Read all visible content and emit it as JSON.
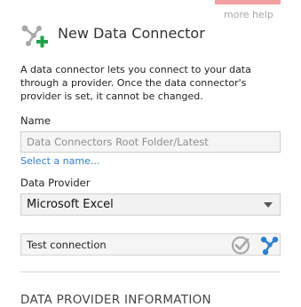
{
  "help": {
    "more_help": "more help"
  },
  "header": {
    "title": "New Data Connector",
    "icon": "data-connector-add-icon"
  },
  "description": "A data connector lets you connect to your data through a provider. Once the data connector's provider is set, it cannot be changed.",
  "name_field": {
    "label": "Name",
    "value": "Data Connectors Root Folder/Latest",
    "select_link": "Select a name..."
  },
  "provider": {
    "label": "Data Provider",
    "selected": "Microsoft Excel"
  },
  "test": {
    "label": "Test connection",
    "check_icon": "check-circle-icon",
    "connect_icon": "connection-icon"
  },
  "section": {
    "title": "DATA PROVIDER INFORMATION"
  },
  "colors": {
    "accent": "#2d7fcf",
    "add_green": "#22a14a",
    "accent_top": "#f2a0a0"
  }
}
